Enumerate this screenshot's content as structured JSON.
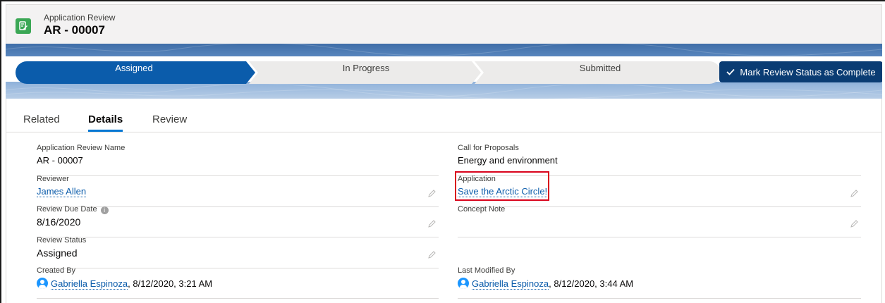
{
  "header": {
    "object_label": "Application Review",
    "record_name": "AR - 00007"
  },
  "path": {
    "stages": [
      {
        "label": "Assigned",
        "state": "current"
      },
      {
        "label": "In Progress",
        "state": "incomplete"
      },
      {
        "label": "Submitted",
        "state": "incomplete"
      }
    ],
    "complete_button": "Mark Review Status as Complete",
    "colors": {
      "current": "#0b5cab",
      "incomplete": "#ecebea",
      "button": "#0a3c73"
    }
  },
  "tabs": [
    {
      "label": "Related",
      "active": false
    },
    {
      "label": "Details",
      "active": true
    },
    {
      "label": "Review",
      "active": false
    }
  ],
  "fields": {
    "review_name": {
      "label": "Application Review Name",
      "value": "AR - 00007"
    },
    "reviewer": {
      "label": "Reviewer",
      "value": "James Allen"
    },
    "due_date": {
      "label": "Review Due Date",
      "value": "8/16/2020"
    },
    "status": {
      "label": "Review Status",
      "value": "Assigned"
    },
    "created_by": {
      "label": "Created By",
      "user": "Gabriella Espinoza",
      "timestamp": ", 8/12/2020, 3:21 AM"
    },
    "call_for_proposals": {
      "label": "Call for Proposals",
      "value": "Energy and environment"
    },
    "application": {
      "label": "Application",
      "value": "Save the Arctic Circle!"
    },
    "concept_note": {
      "label": "Concept Note",
      "value": ""
    },
    "last_modified_by": {
      "label": "Last Modified By",
      "user": "Gabriella Espinoza",
      "timestamp": ", 8/12/2020, 3:44 AM"
    }
  },
  "icons": {
    "object": "application-review-icon",
    "check": "check-icon",
    "pencil": "pencil-icon",
    "info": "info-icon",
    "avatar": "user-avatar-icon"
  },
  "accent": "#d9041c"
}
